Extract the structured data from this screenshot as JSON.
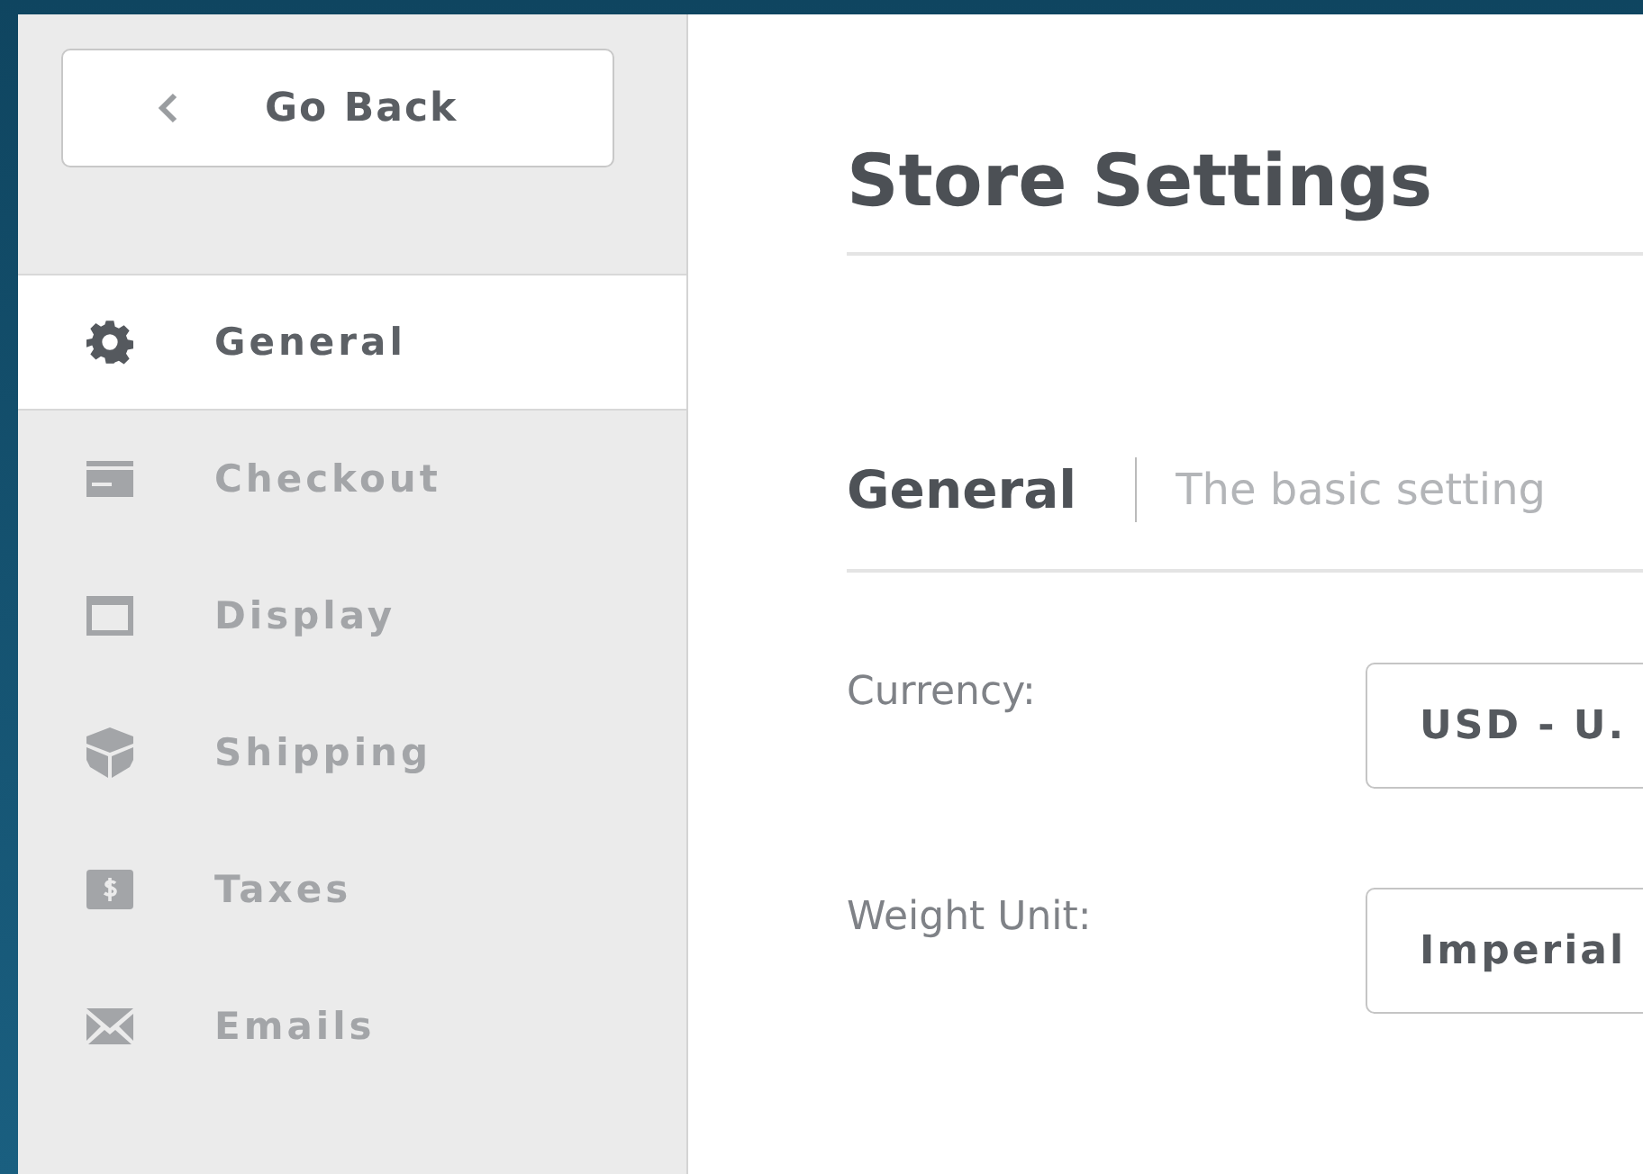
{
  "back_button": {
    "label": "Go Back"
  },
  "sidebar": {
    "items": [
      {
        "label": "General",
        "selected": true
      },
      {
        "label": "Checkout",
        "selected": false
      },
      {
        "label": "Display",
        "selected": false
      },
      {
        "label": "Shipping",
        "selected": false
      },
      {
        "label": "Taxes",
        "selected": false
      },
      {
        "label": "Emails",
        "selected": false
      }
    ]
  },
  "page_title": "Store Settings",
  "section": {
    "title": "General",
    "subtitle": "The basic setting"
  },
  "fields": [
    {
      "label": "Currency:",
      "value": "USD - U."
    },
    {
      "label": "Weight Unit:",
      "value": "Imperial"
    }
  ]
}
